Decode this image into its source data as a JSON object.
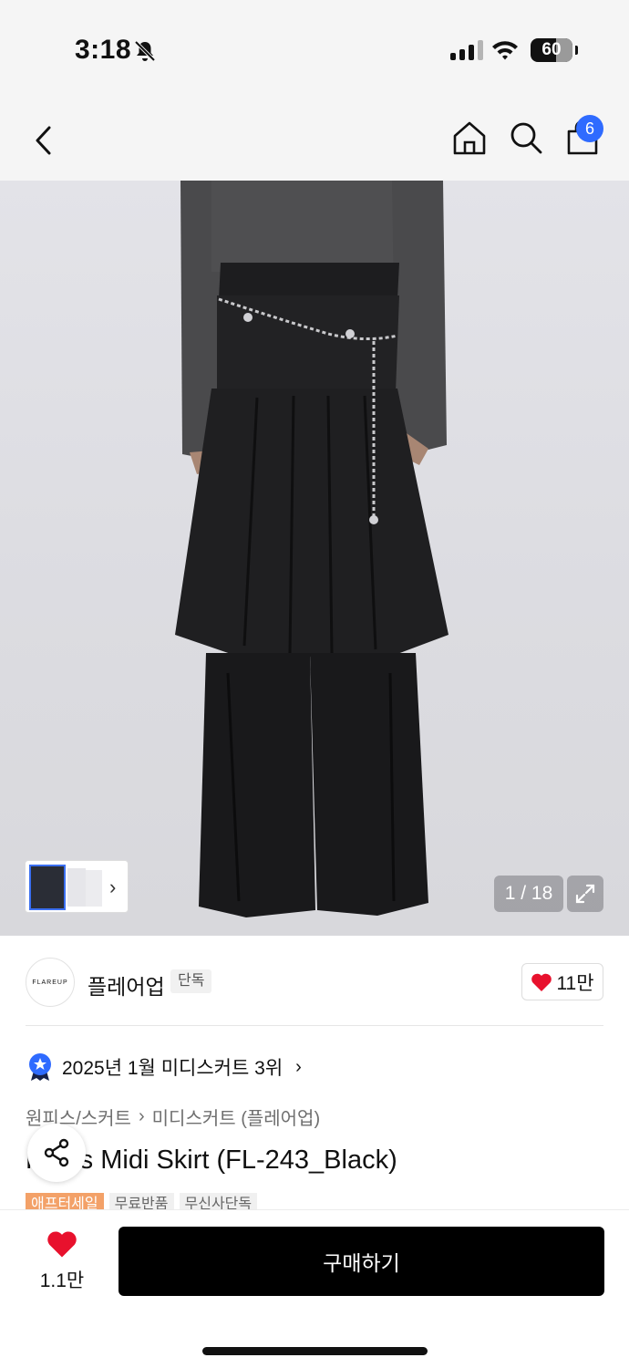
{
  "status_bar": {
    "time": "3:18",
    "battery": "60"
  },
  "nav": {
    "cart_count": "6"
  },
  "gallery": {
    "counter": "1 / 18"
  },
  "brand": {
    "logo_text": "FLAREUP",
    "name": "플레어업",
    "tag": "단독",
    "likes": "11만"
  },
  "ranking": {
    "text": "2025년 1월 미디스커트 3위"
  },
  "breadcrumb": {
    "level1": "원피스/스커트",
    "level2": "미디스커트 (플레어업)"
  },
  "product": {
    "title": "Pants Midi Skirt (FL-243_Black)"
  },
  "tags": [
    "애프터세일",
    "무료반품",
    "무신사단독"
  ],
  "bottom": {
    "likes": "1.1만",
    "buy_label": "구매하기"
  },
  "colors": {
    "accent_blue": "#2f6bff",
    "heart_red": "#e8112d",
    "tag_orange": "#f3a168"
  }
}
